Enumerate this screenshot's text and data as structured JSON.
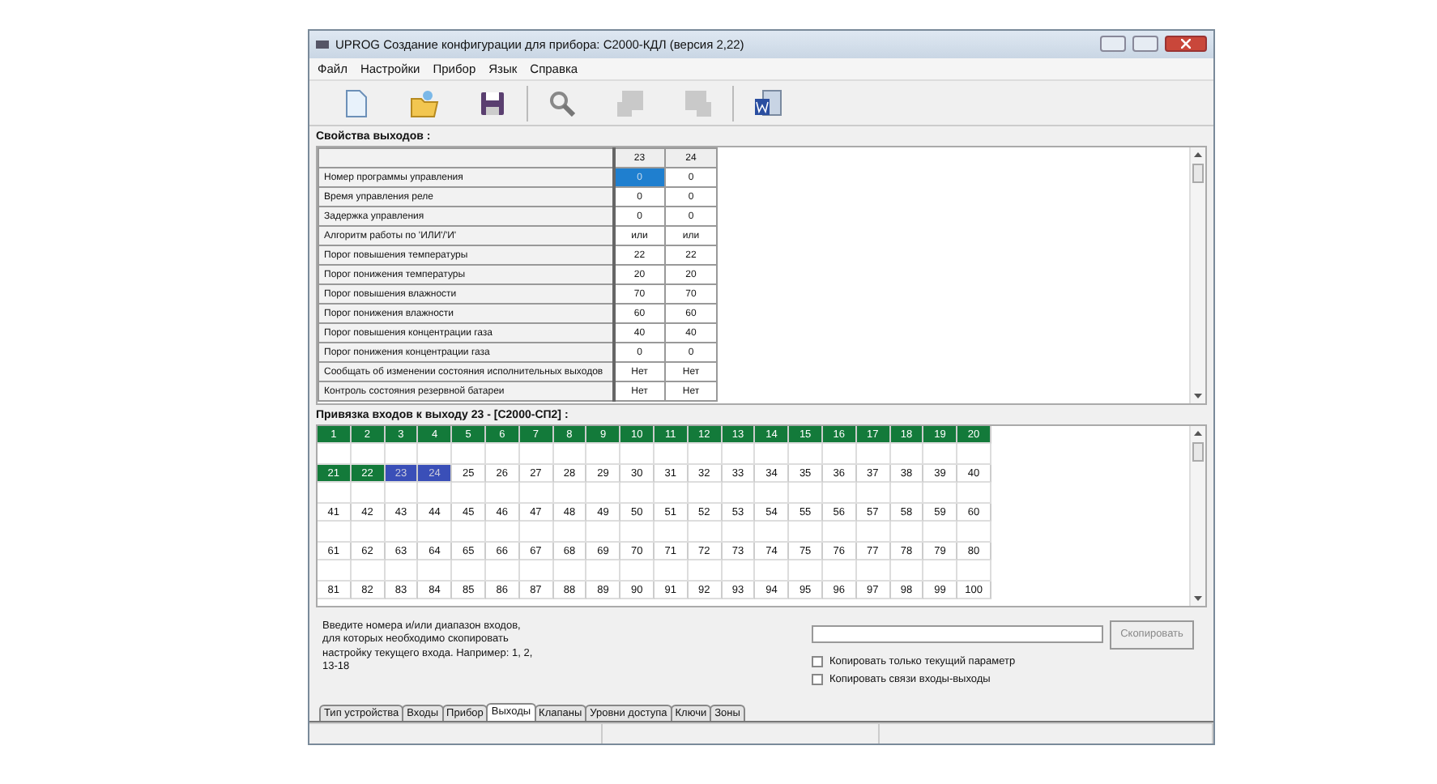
{
  "window": {
    "title": "UPROG  Создание конфигурации для прибора: С2000-КДЛ (версия  2,22)"
  },
  "menu": [
    "Файл",
    "Настройки",
    "Прибор",
    "Язык",
    "Справка"
  ],
  "toolbar": [
    {
      "kind": "new",
      "disabled": false
    },
    {
      "kind": "open",
      "disabled": false
    },
    {
      "kind": "save",
      "disabled": false
    },
    {
      "kind": "search",
      "disabled": false
    },
    {
      "kind": "read",
      "disabled": true
    },
    {
      "kind": "write",
      "disabled": true
    },
    {
      "kind": "report",
      "disabled": false
    }
  ],
  "properties": {
    "title": "Свойства выходов :",
    "columns": [
      "23",
      "24"
    ],
    "rows": [
      {
        "label": "Номер программы управления",
        "values": [
          {
            "text": "0",
            "selected": true
          },
          {
            "text": "0",
            "selected": false
          }
        ]
      },
      {
        "label": "Время управления реле",
        "values": [
          {
            "text": "0",
            "selected": false
          },
          {
            "text": "0",
            "selected": false
          }
        ]
      },
      {
        "label": "Задержка управления",
        "values": [
          {
            "text": "0",
            "selected": false
          },
          {
            "text": "0",
            "selected": false
          }
        ]
      },
      {
        "label": "Алгоритм работы по 'ИЛИ'/'И'",
        "values": [
          {
            "text": "или",
            "selected": false
          },
          {
            "text": "или",
            "selected": false
          }
        ]
      },
      {
        "label": "Порог повышения температуры",
        "values": [
          {
            "text": "22",
            "selected": false
          },
          {
            "text": "22",
            "selected": false
          }
        ]
      },
      {
        "label": "Порог понижения температуры",
        "values": [
          {
            "text": "20",
            "selected": false
          },
          {
            "text": "20",
            "selected": false
          }
        ]
      },
      {
        "label": "Порог повышения влажности",
        "values": [
          {
            "text": "70",
            "selected": false
          },
          {
            "text": "70",
            "selected": false
          }
        ]
      },
      {
        "label": "Порог понижения влажности",
        "values": [
          {
            "text": "60",
            "selected": false
          },
          {
            "text": "60",
            "selected": false
          }
        ]
      },
      {
        "label": "Порог повышения концентрации газа",
        "values": [
          {
            "text": "40",
            "selected": false
          },
          {
            "text": "40",
            "selected": false
          }
        ]
      },
      {
        "label": "Порог понижения концентрации газа",
        "values": [
          {
            "text": "0",
            "selected": false
          },
          {
            "text": "0",
            "selected": false
          }
        ]
      },
      {
        "label": "Сообщать об изменении состояния исполнительных выходов",
        "values": [
          {
            "text": "Нет",
            "selected": false
          },
          {
            "text": "Нет",
            "selected": false
          }
        ]
      },
      {
        "label": "Контроль состояния резервной батареи",
        "values": [
          {
            "text": "Нет",
            "selected": false
          },
          {
            "text": "Нет",
            "selected": false
          }
        ]
      }
    ]
  },
  "binding": {
    "title": "Привязка входов к выходу 23 - [С2000-СП2] :",
    "cells": [
      {
        "text": "1",
        "bound": true,
        "selected": false
      },
      {
        "text": "2",
        "bound": true,
        "selected": false
      },
      {
        "text": "3",
        "bound": true,
        "selected": false
      },
      {
        "text": "4",
        "bound": true,
        "selected": false
      },
      {
        "text": "5",
        "bound": true,
        "selected": false
      },
      {
        "text": "6",
        "bound": true,
        "selected": false
      },
      {
        "text": "7",
        "bound": true,
        "selected": false
      },
      {
        "text": "8",
        "bound": true,
        "selected": false
      },
      {
        "text": "9",
        "bound": true,
        "selected": false
      },
      {
        "text": "10",
        "bound": true,
        "selected": false
      },
      {
        "text": "11",
        "bound": true,
        "selected": false
      },
      {
        "text": "12",
        "bound": true,
        "selected": false
      },
      {
        "text": "13",
        "bound": true,
        "selected": false
      },
      {
        "text": "14",
        "bound": true,
        "selected": false
      },
      {
        "text": "15",
        "bound": true,
        "selected": false
      },
      {
        "text": "16",
        "bound": true,
        "selected": false
      },
      {
        "text": "17",
        "bound": true,
        "selected": false
      },
      {
        "text": "18",
        "bound": true,
        "selected": false
      },
      {
        "text": "19",
        "bound": true,
        "selected": false
      },
      {
        "text": "20",
        "bound": true,
        "selected": false
      },
      {
        "text": "21",
        "bound": true,
        "selected": false
      },
      {
        "text": "22",
        "bound": true,
        "selected": false
      },
      {
        "text": "23",
        "bound": false,
        "selected": true
      },
      {
        "text": "24",
        "bound": false,
        "selected": true
      },
      {
        "text": "25",
        "bound": false,
        "selected": false
      },
      {
        "text": "26",
        "bound": false,
        "selected": false
      },
      {
        "text": "27",
        "bound": false,
        "selected": false
      },
      {
        "text": "28",
        "bound": false,
        "selected": false
      },
      {
        "text": "29",
        "bound": false,
        "selected": false
      },
      {
        "text": "30",
        "bound": false,
        "selected": false
      },
      {
        "text": "31",
        "bound": false,
        "selected": false
      },
      {
        "text": "32",
        "bound": false,
        "selected": false
      },
      {
        "text": "33",
        "bound": false,
        "selected": false
      },
      {
        "text": "34",
        "bound": false,
        "selected": false
      },
      {
        "text": "35",
        "bound": false,
        "selected": false
      },
      {
        "text": "36",
        "bound": false,
        "selected": false
      },
      {
        "text": "37",
        "bound": false,
        "selected": false
      },
      {
        "text": "38",
        "bound": false,
        "selected": false
      },
      {
        "text": "39",
        "bound": false,
        "selected": false
      },
      {
        "text": "40",
        "bound": false,
        "selected": false
      },
      {
        "text": "41",
        "bound": false,
        "selected": false
      },
      {
        "text": "42",
        "bound": false,
        "selected": false
      },
      {
        "text": "43",
        "bound": false,
        "selected": false
      },
      {
        "text": "44",
        "bound": false,
        "selected": false
      },
      {
        "text": "45",
        "bound": false,
        "selected": false
      },
      {
        "text": "46",
        "bound": false,
        "selected": false
      },
      {
        "text": "47",
        "bound": false,
        "selected": false
      },
      {
        "text": "48",
        "bound": false,
        "selected": false
      },
      {
        "text": "49",
        "bound": false,
        "selected": false
      },
      {
        "text": "50",
        "bound": false,
        "selected": false
      },
      {
        "text": "51",
        "bound": false,
        "selected": false
      },
      {
        "text": "52",
        "bound": false,
        "selected": false
      },
      {
        "text": "53",
        "bound": false,
        "selected": false
      },
      {
        "text": "54",
        "bound": false,
        "selected": false
      },
      {
        "text": "55",
        "bound": false,
        "selected": false
      },
      {
        "text": "56",
        "bound": false,
        "selected": false
      },
      {
        "text": "57",
        "bound": false,
        "selected": false
      },
      {
        "text": "58",
        "bound": false,
        "selected": false
      },
      {
        "text": "59",
        "bound": false,
        "selected": false
      },
      {
        "text": "60",
        "bound": false,
        "selected": false
      },
      {
        "text": "61",
        "bound": false,
        "selected": false
      },
      {
        "text": "62",
        "bound": false,
        "selected": false
      },
      {
        "text": "63",
        "bound": false,
        "selected": false
      },
      {
        "text": "64",
        "bound": false,
        "selected": false
      },
      {
        "text": "65",
        "bound": false,
        "selected": false
      },
      {
        "text": "66",
        "bound": false,
        "selected": false
      },
      {
        "text": "67",
        "bound": false,
        "selected": false
      },
      {
        "text": "68",
        "bound": false,
        "selected": false
      },
      {
        "text": "69",
        "bound": false,
        "selected": false
      },
      {
        "text": "70",
        "bound": false,
        "selected": false
      },
      {
        "text": "71",
        "bound": false,
        "selected": false
      },
      {
        "text": "72",
        "bound": false,
        "selected": false
      },
      {
        "text": "73",
        "bound": false,
        "selected": false
      },
      {
        "text": "74",
        "bound": false,
        "selected": false
      },
      {
        "text": "75",
        "bound": false,
        "selected": false
      },
      {
        "text": "76",
        "bound": false,
        "selected": false
      },
      {
        "text": "77",
        "bound": false,
        "selected": false
      },
      {
        "text": "78",
        "bound": false,
        "selected": false
      },
      {
        "text": "79",
        "bound": false,
        "selected": false
      },
      {
        "text": "80",
        "bound": false,
        "selected": false
      },
      {
        "text": "81",
        "bound": false,
        "selected": false
      },
      {
        "text": "82",
        "bound": false,
        "selected": false
      },
      {
        "text": "83",
        "bound": false,
        "selected": false
      },
      {
        "text": "84",
        "bound": false,
        "selected": false
      },
      {
        "text": "85",
        "bound": false,
        "selected": false
      },
      {
        "text": "86",
        "bound": false,
        "selected": false
      },
      {
        "text": "87",
        "bound": false,
        "selected": false
      },
      {
        "text": "88",
        "bound": false,
        "selected": false
      },
      {
        "text": "89",
        "bound": false,
        "selected": false
      },
      {
        "text": "90",
        "bound": false,
        "selected": false
      },
      {
        "text": "91",
        "bound": false,
        "selected": false
      },
      {
        "text": "92",
        "bound": false,
        "selected": false
      },
      {
        "text": "93",
        "bound": false,
        "selected": false
      },
      {
        "text": "94",
        "bound": false,
        "selected": false
      },
      {
        "text": "95",
        "bound": false,
        "selected": false
      },
      {
        "text": "96",
        "bound": false,
        "selected": false
      },
      {
        "text": "97",
        "bound": false,
        "selected": false
      },
      {
        "text": "98",
        "bound": false,
        "selected": false
      },
      {
        "text": "99",
        "bound": false,
        "selected": false
      },
      {
        "text": "100",
        "bound": false,
        "selected": false
      }
    ]
  },
  "copy": {
    "hint": "Введите номера и/или диапазон входов, для которых необходимо скопировать настройку текущего входа. Например: 1, 2, 13-18",
    "button": {
      "label": "Скопировать",
      "disabled": true
    },
    "checkboxes": [
      {
        "label": "Копировать только текущий параметр",
        "checked": false
      },
      {
        "label": "Копировать связи входы-выходы",
        "checked": false
      }
    ]
  },
  "tabs": [
    {
      "label": "Тип устройства",
      "selected": false
    },
    {
      "label": "Входы",
      "selected": false
    },
    {
      "label": "Прибор",
      "selected": false
    },
    {
      "label": "Выходы",
      "selected": true
    },
    {
      "label": "Клапаны",
      "selected": false
    },
    {
      "label": "Уровни доступа",
      "selected": false
    },
    {
      "label": "Ключи",
      "selected": false
    },
    {
      "label": "Зоны",
      "selected": false
    }
  ]
}
